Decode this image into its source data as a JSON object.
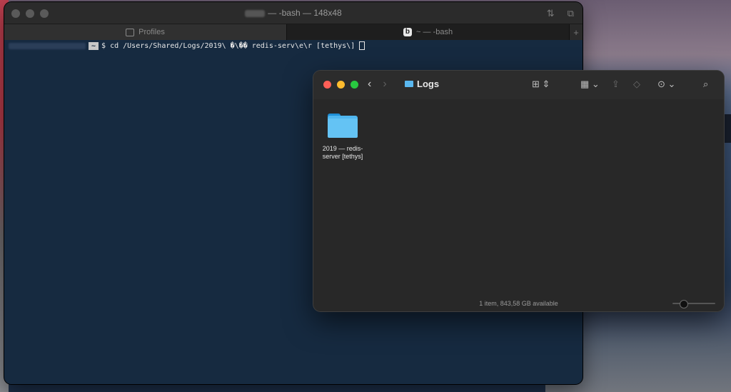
{
  "terminal": {
    "title": "— -bash — 148x48",
    "tabs": [
      {
        "label": "Profiles"
      },
      {
        "badge": "b",
        "label": "~ — -bash"
      }
    ],
    "prompt_tilde": "~",
    "command": "$ cd /Users/Shared/Logs/2019\\ �\\�� redis-serv\\e\\r [tethys\\]"
  },
  "finder": {
    "title": "Logs",
    "items": [
      {
        "label_line1": "2019 — redis-",
        "label_line2": "server [tethys]"
      }
    ],
    "status": "1 item, 843,58 GB available",
    "icon_size": 0.2
  }
}
